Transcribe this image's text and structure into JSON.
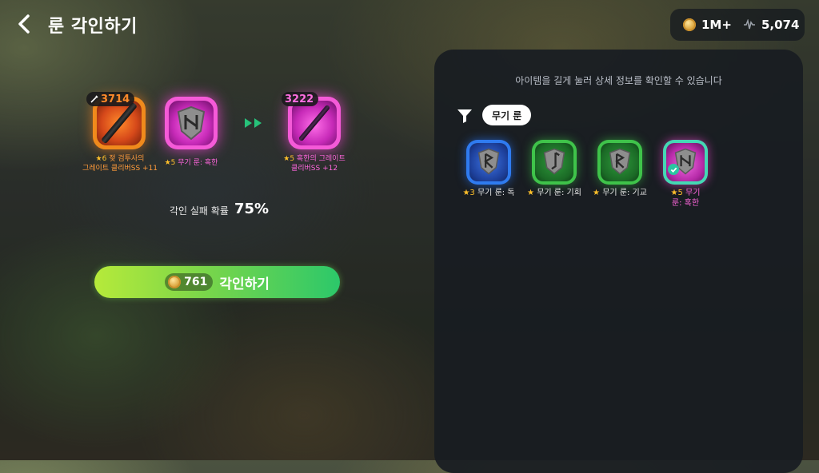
{
  "header": {
    "title": "룬 각인하기",
    "coins": "1M+",
    "points": "5,074"
  },
  "engrave": {
    "weapon": {
      "power": "3714",
      "caption_star": "★6",
      "caption_line1": "젖 검투사의",
      "caption_line2": "그레이트 클리버SS +11"
    },
    "rune": {
      "caption_star": "★5",
      "caption": "무기 룬: 혹한"
    },
    "result": {
      "power": "3222",
      "caption_star": "★5",
      "caption_line1": "혹한의 그레이트",
      "caption_line2": "클리버SS +12"
    },
    "fail_label": "각인 실패 확률",
    "fail_value": "75%",
    "button_cost": "761",
    "button_label": "각인하기"
  },
  "panel": {
    "hint": "아이템을 길게 눌러 상세 정보를 확인할 수 있습니다",
    "filter_chip": "무기 룬",
    "items": [
      {
        "star": "★3",
        "label": "무기 룬: 독",
        "color": "blue"
      },
      {
        "star": "★",
        "label": "무기 룬: 기회",
        "color": "green"
      },
      {
        "star": "★",
        "label": "무기 룬: 기교",
        "color": "green"
      },
      {
        "star": "★5",
        "label_line1": "무기",
        "label_line2": "룬: 혹한",
        "color": "pink",
        "selected": true
      }
    ]
  },
  "colors": {
    "accent_green": "#2cc86a",
    "accent_lime": "#b6ea3a",
    "star": "#ffc02a",
    "legendary_pink": "#ff66dd",
    "orange": "#ff9a3a"
  },
  "icons": [
    "back-chevron-icon",
    "coin-icon",
    "wave-icon",
    "sword-icon",
    "rune-icon",
    "double-arrow-icon",
    "filter-icon",
    "check-icon"
  ]
}
